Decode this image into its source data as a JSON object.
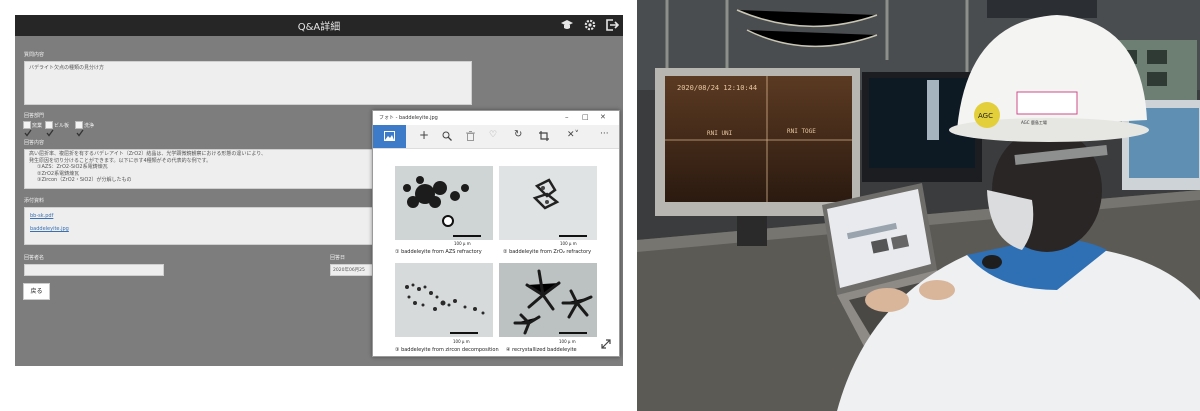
{
  "app": {
    "title": "Q&A詳細",
    "question_label": "質問内容",
    "question_text": "バデライト欠点の種類の見分け方",
    "dept_label": "回答部門",
    "departments": [
      {
        "label": "窯業",
        "checked": true
      },
      {
        "label": "ビル板",
        "checked": true
      },
      {
        "label": "洗浄",
        "checked": true
      }
    ],
    "answer_label": "回答内容",
    "answer_lines": [
      "高い屈折率、複屈折を有するバデレアイト（ZrO2）結晶は、光学顕微鏡観察における形態の違いにより、",
      "発生原因を切り分けることができます。以下に示す4種類がその代表的な例です。",
      "①AZS：ZrO2-SiO2系電鋳煉瓦",
      "②ZrO2系電鋳煉瓦",
      "③Zircon（ZrO2・SiO2）が分解したもの"
    ],
    "attach_label": "添付資料",
    "attachments": [
      "bb-sk.pdf",
      "baddeleyite.jpg"
    ],
    "answerer_label": "回答者名",
    "answerer_value": "",
    "date_label": "回答日",
    "date_value": "2020年06月25",
    "back_button": "戻る",
    "icons": [
      "graduation-cap-icon",
      "gear-icon",
      "logout-icon"
    ]
  },
  "photos": {
    "title": "フォト - baddeleyite.jpg",
    "images": [
      {
        "caption": "① baddeleyite from AZS refractory",
        "scale": "100 μ m"
      },
      {
        "caption": "② baddeleyite from ZrO₂ refractory",
        "scale": "100 μ m"
      },
      {
        "caption": "③ baddeleyite from zircon decomposition",
        "scale": "100 μ m"
      },
      {
        "caption": "④ recrystallized baddeleyite",
        "scale": "100 μ m"
      }
    ]
  },
  "photo_scene": {
    "monitor_timestamp": "2020/08/24  12:10:44",
    "monitor_text_1": "RNI  UNI",
    "monitor_text_2": "RNI  TOGE",
    "helmet_badge": "AGC",
    "helmet_sticker": "AGC 鹿島工場"
  },
  "colors": {
    "app_bg": "#7d7d7d",
    "header_bg": "#262626",
    "photos_accent": "#3d7bc8"
  }
}
